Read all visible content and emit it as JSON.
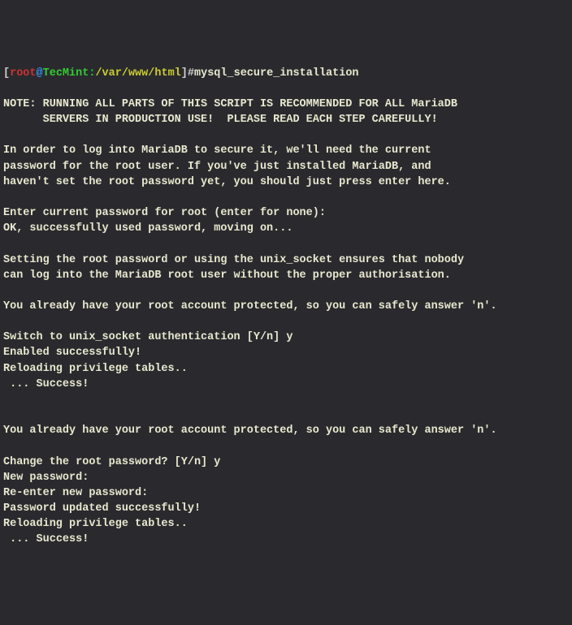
{
  "prompt": {
    "open": "[",
    "root": "root",
    "at": "@",
    "host": "TecMint",
    "sep": ":",
    "path": "/var/www/html",
    "close": "]",
    "hash": "#",
    "command": "mysql_secure_installation"
  },
  "lines": [
    "",
    "NOTE: RUNNING ALL PARTS OF THIS SCRIPT IS RECOMMENDED FOR ALL MariaDB",
    "      SERVERS IN PRODUCTION USE!  PLEASE READ EACH STEP CAREFULLY!",
    "",
    "In order to log into MariaDB to secure it, we'll need the current",
    "password for the root user. If you've just installed MariaDB, and",
    "haven't set the root password yet, you should just press enter here.",
    "",
    "Enter current password for root (enter for none):",
    "OK, successfully used password, moving on...",
    "",
    "Setting the root password or using the unix_socket ensures that nobody",
    "can log into the MariaDB root user without the proper authorisation.",
    "",
    "You already have your root account protected, so you can safely answer 'n'.",
    "",
    "Switch to unix_socket authentication [Y/n] y",
    "Enabled successfully!",
    "Reloading privilege tables..",
    " ... Success!",
    "",
    "",
    "You already have your root account protected, so you can safely answer 'n'.",
    "",
    "Change the root password? [Y/n] y",
    "New password:",
    "Re-enter new password:",
    "Password updated successfully!",
    "Reloading privilege tables..",
    " ... Success!"
  ]
}
